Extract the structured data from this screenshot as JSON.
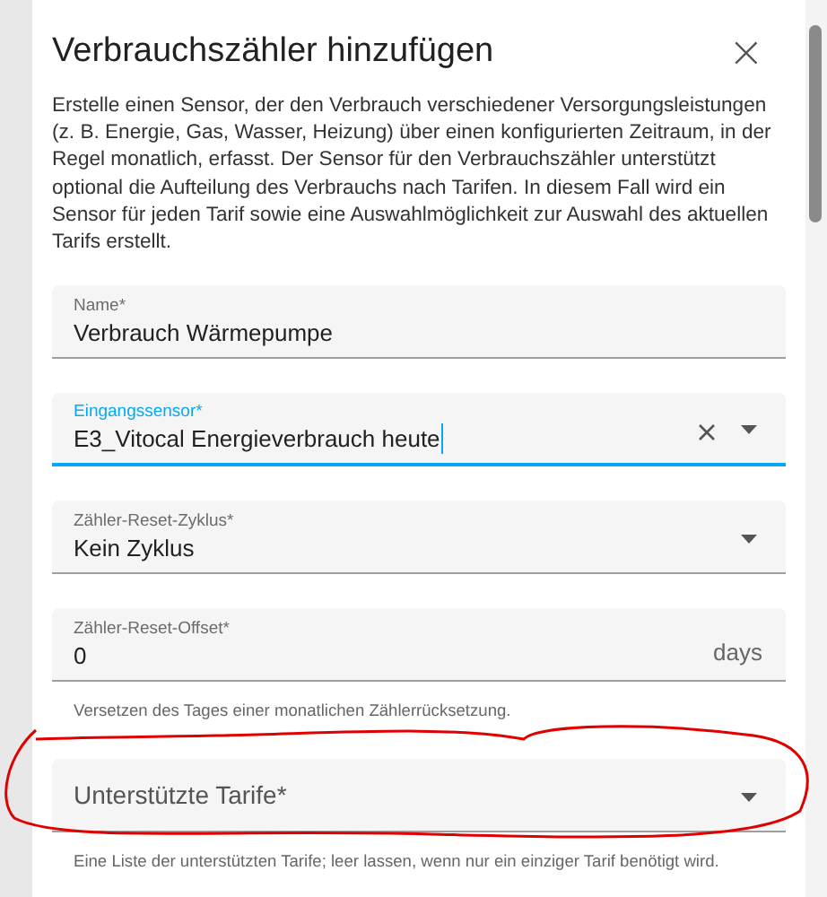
{
  "dialog": {
    "title": "Verbrauchszähler hinzufügen",
    "close": "×",
    "description": "Erstelle einen Sensor, der den Verbrauch verschiedener Versorgungsleistungen (z. B. Energie, Gas, Wasser, Heizung) über einen konfigurierten Zeitraum, in der Regel monatlich, erfasst. Der Sensor für den Verbrauchszähler unterstützt optional die Aufteilung des Verbrauchs nach Tarifen. In diesem Fall wird ein Sensor für jeden Tarif sowie eine Auswahlmöglichkeit zur Auswahl des aktuellen Tarifs erstellt."
  },
  "fields": [
    {
      "kind": "text",
      "label": "Name*",
      "value": "Verbrauch Wärmepumpe",
      "focused": false
    },
    {
      "kind": "select",
      "label": "Eingangssensor*",
      "value": "E3_Vitocal Energieverbrauch heute",
      "focused": true,
      "clearable": true
    },
    {
      "kind": "select",
      "label": "Zähler-Reset-Zyklus*",
      "value": "Kein Zyklus",
      "focused": false
    },
    {
      "kind": "text",
      "label": "Zähler-Reset-Offset*",
      "value": "0",
      "suffix": "days",
      "focused": false,
      "helper": "Versetzen des Tages einer monatlichen Zählerrücksetzung."
    },
    {
      "kind": "select",
      "label": "Unterstützte Tarife*",
      "focused": false,
      "helper": "Eine Liste der unterstützten Tarife; leer lassen, wenn nur ein einziger Tarif benötigt wird."
    }
  ]
}
